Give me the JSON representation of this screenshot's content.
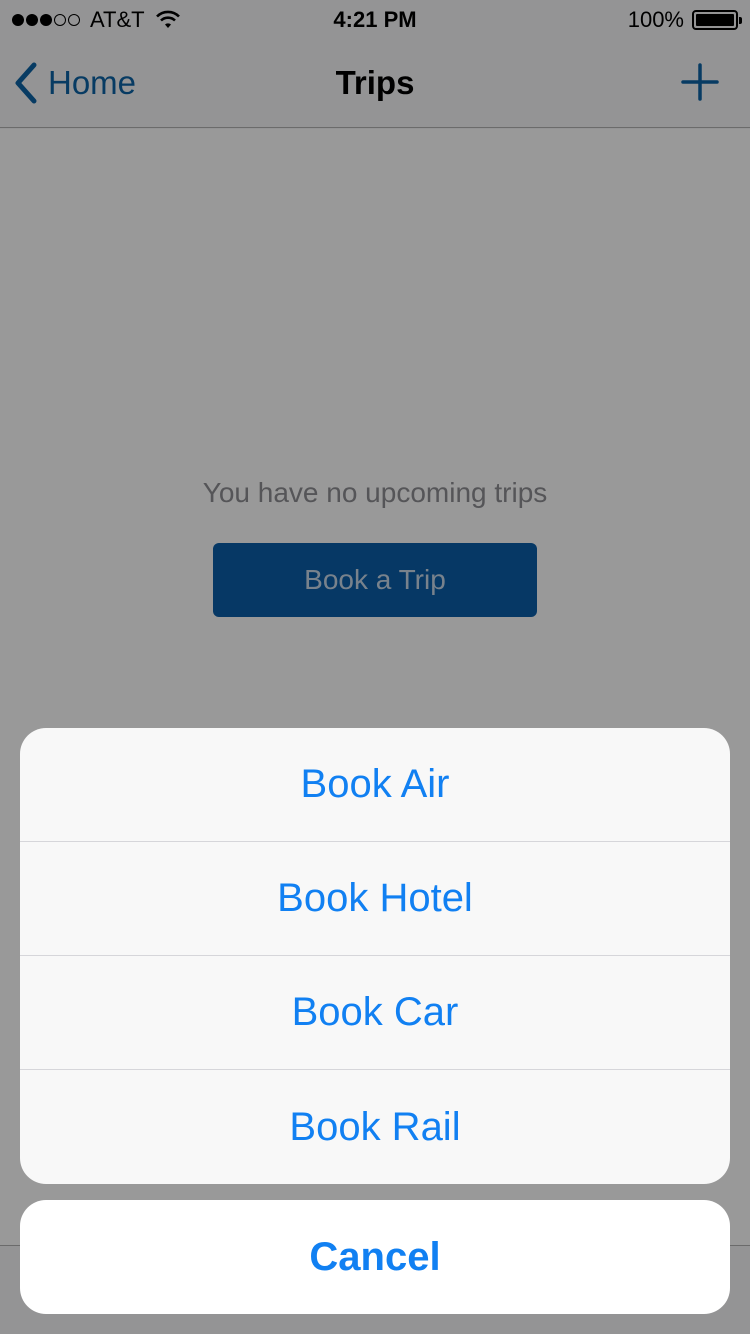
{
  "status_bar": {
    "carrier": "AT&T",
    "time": "4:21 PM",
    "battery": "100%",
    "signal_bars_filled": 3,
    "signal_bars_total": 5,
    "battery_level": 1.0
  },
  "nav": {
    "back_label": "Home",
    "title": "Trips",
    "add_icon": "plus-icon",
    "back_icon": "chevron-left-icon"
  },
  "content": {
    "empty_message": "You have no upcoming trips",
    "book_trip_label": "Book a Trip"
  },
  "action_sheet": {
    "items": [
      {
        "label": "Book Air"
      },
      {
        "label": "Book Hotel"
      },
      {
        "label": "Book Car"
      },
      {
        "label": "Book Rail"
      }
    ],
    "cancel_label": "Cancel"
  },
  "colors": {
    "accent": "#1180f2",
    "nav_tint": "#0d63a5",
    "button_bg": "#0b5ea8"
  }
}
